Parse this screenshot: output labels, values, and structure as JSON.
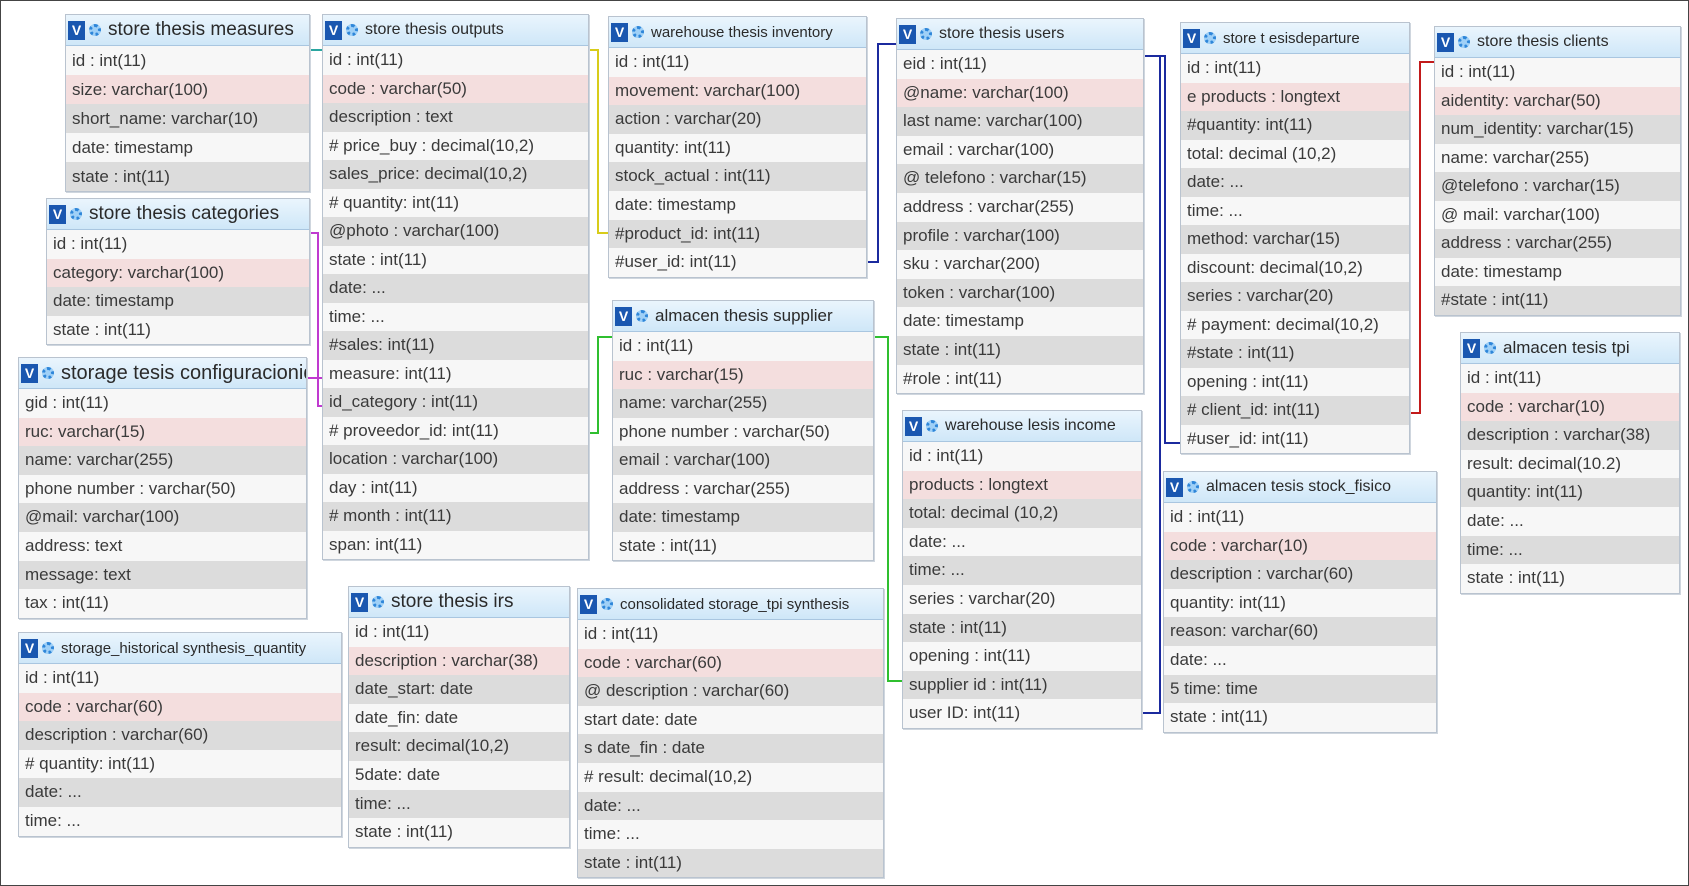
{
  "tables": [
    {
      "id": "t_measures",
      "title": "store thesis measures",
      "fields": [
        "id : int(11)",
        "size: varchar(100)",
        "short_name: varchar(10)",
        "date: timestamp",
        "state : int(11)"
      ]
    },
    {
      "id": "t_outputs",
      "title": "store thesis outputs",
      "fields": [
        "id : int(11)",
        "code : varchar(50)",
        "description : text",
        "# price_buy : decimal(10,2)",
        "sales_price: decimal(10,2)",
        "# quantity: int(11)",
        "@photo : varchar(100)",
        "state : int(11)",
        "date: ...",
        "time: ...",
        "#sales: int(11)",
        "measure: int(11)",
        "id_category : int(11)",
        "# proveedor_id: int(11)",
        "location : varchar(100)",
        "day : int(11)",
        "# month : int(11)",
        "span: int(11)"
      ]
    },
    {
      "id": "t_inventory",
      "title": "warehouse thesis inventory",
      "fields": [
        "id : int(11)",
        "movement: varchar(100)",
        "action : varchar(20)",
        "quantity: int(11)",
        "stock_actual : int(11)",
        "date: timestamp",
        "#product_id: int(11)",
        "#user_id: int(11)"
      ]
    },
    {
      "id": "t_users",
      "title": "store thesis users",
      "fields": [
        "eid : int(11)",
        "@name: varchar(100)",
        "last name: varchar(100)",
        "email : varchar(100)",
        "@ telefono : varchar(15)",
        "address : varchar(255)",
        "profile : varchar(100)",
        "sku : varchar(200)",
        "token : varchar(100)",
        "date: timestamp",
        "state : int(11)",
        "#role : int(11)"
      ]
    },
    {
      "id": "t_departure",
      "title": "store t          esisdeparture",
      "fields": [
        "id : int(11)",
        "e products : longtext",
        "#quantity: int(11)",
        "total: decimal (10,2)",
        "date: ...",
        "time: ...",
        "method: varchar(15)",
        "discount: decimal(10,2)",
        "series : varchar(20)",
        "# payment: decimal(10,2)",
        "#state : int(11)",
        "opening : int(11)",
        "# client_id: int(11)",
        "#user_id: int(11)"
      ]
    },
    {
      "id": "t_clients",
      "title": "store thesis clients",
      "fields": [
        "id : int(11)",
        "aidentity: varchar(50)",
        "num_identity: varchar(15)",
        "name: varchar(255)",
        "@telefono : varchar(15)",
        "@ mail: varchar(100)",
        "address : varchar(255)",
        "date: timestamp",
        "#state : int(11)"
      ]
    },
    {
      "id": "t_categories",
      "title": "store thesis categories",
      "fields": [
        "id : int(11)",
        "category: varchar(100)",
        "date: timestamp",
        "state : int(11)"
      ]
    },
    {
      "id": "t_config",
      "title": "storage tesis configuracionid",
      "fields": [
        "gid : int(11)",
        "ruc: varchar(15)",
        "name: varchar(255)",
        "phone number : varchar(50)",
        "@mail: varchar(100)",
        "address: text",
        "message: text",
        "tax : int(11)"
      ]
    },
    {
      "id": "t_supplier",
      "title": "almacen thesis supplier",
      "fields": [
        "id : int(11)",
        "ruc : varchar(15)",
        "name: varchar(255)",
        "phone number : varchar(50)",
        "email : varchar(100)",
        "address : varchar(255)",
        "date: timestamp",
        "state : int(11)"
      ]
    },
    {
      "id": "t_income",
      "title": "warehouse lesis income",
      "fields": [
        "id : int(11)",
        "products : longtext",
        "total: decimal (10,2)",
        "date: ...",
        "time: ...",
        "series : varchar(20)",
        "state : int(11)",
        "opening : int(11)",
        "supplier id : int(11)",
        "user ID: int(11)"
      ]
    },
    {
      "id": "t_tpi",
      "title": "almacen tesis tpi",
      "fields": [
        "id : int(11)",
        "code : varchar(10)",
        "description : varchar(38)",
        "result: decimal(10.2)",
        "quantity: int(11)",
        "date: ...",
        "time: ...",
        "state : int(11)"
      ]
    },
    {
      "id": "t_stock",
      "title": "almacen tesis stock_fisico",
      "fields": [
        "id : int(11)",
        "code : varchar(10)",
        "description : varchar(60)",
        "quantity: int(11)",
        "reason: varchar(60)",
        "date: ...",
        "5 time: time",
        "state : int(11)"
      ]
    },
    {
      "id": "t_historical",
      "title": "storage_historical synthesis_quantity",
      "fields": [
        "id : int(11)",
        "code : varchar(60)",
        "description : varchar(60)",
        "# quantity: int(11)",
        "date: ...",
        "time: ..."
      ]
    },
    {
      "id": "t_irs",
      "title": "store thesis irs",
      "fields": [
        "id : int(11)",
        "description : varchar(38)",
        "date_start: date",
        "date_fin: date",
        "result: decimal(10,2)",
        "5date: date",
        "time: ...",
        "state : int(11)"
      ]
    },
    {
      "id": "t_consolidated",
      "title": "consolidated storage_tpi synthesis",
      "fields": [
        "id : int(11)",
        "code : varchar(60)",
        "@ description : varchar(60)",
        "start date: date",
        "s date_fin : date",
        "# result: decimal(10,2)",
        "date: ...",
        "time: ...",
        "state : int(11)"
      ]
    }
  ],
  "link_colors": {
    "teal": "#2aa6a0",
    "yellow": "#d8cc1a",
    "navy": "#1b2a9e",
    "purple": "#c03ad0",
    "green": "#2fbf2f",
    "red": "#c21a1a"
  }
}
